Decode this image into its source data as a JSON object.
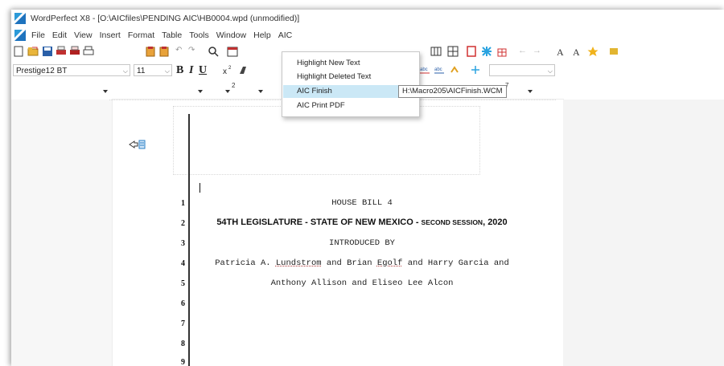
{
  "window": {
    "title": "WordPerfect X8 - [O:\\AICfiles\\PENDING AIC\\HB0004.wpd (unmodified)]"
  },
  "menubar": {
    "items": [
      "File",
      "Edit",
      "View",
      "Insert",
      "Format",
      "Table",
      "Tools",
      "Window",
      "Help",
      "AIC"
    ]
  },
  "propertybar": {
    "font_name": "Prestige12 BT",
    "font_size": "11",
    "bold_label": "B",
    "italic_label": "I",
    "underline_label": "U"
  },
  "ruler": {
    "marks": [
      "2",
      "7"
    ]
  },
  "aic_menu": {
    "items": [
      "Highlight New Text",
      "Highlight Deleted Text",
      "AIC Finish",
      "AIC Print PDF"
    ],
    "highlighted": "AIC Finish",
    "tooltip": "H:\\Macro205\\AICFinish.WCM"
  },
  "document": {
    "line_numbers": [
      "1",
      "2",
      "3",
      "4",
      "5",
      "6",
      "7",
      "8",
      "9"
    ],
    "bill_title": "HOUSE BILL 4",
    "session_main": "54TH LEGISLATURE - STATE OF NEW MEXICO - ",
    "session_small": "SECOND SESSION",
    "session_year": ", 2020",
    "introduced_by": "INTRODUCED BY",
    "sponsors_pre": "Patricia A. ",
    "sponsor_lundstrom": "Lundstrom",
    "sponsors_mid": " and Brian ",
    "sponsor_egolf": "Egolf",
    "sponsors_post": " and Harry Garcia and",
    "sponsors_line2": "Anthony Allison and Eliseo Lee Alcon"
  },
  "colors": {
    "menu_highlight": "#cbe8f6",
    "accent_blue": "#1e73be"
  }
}
